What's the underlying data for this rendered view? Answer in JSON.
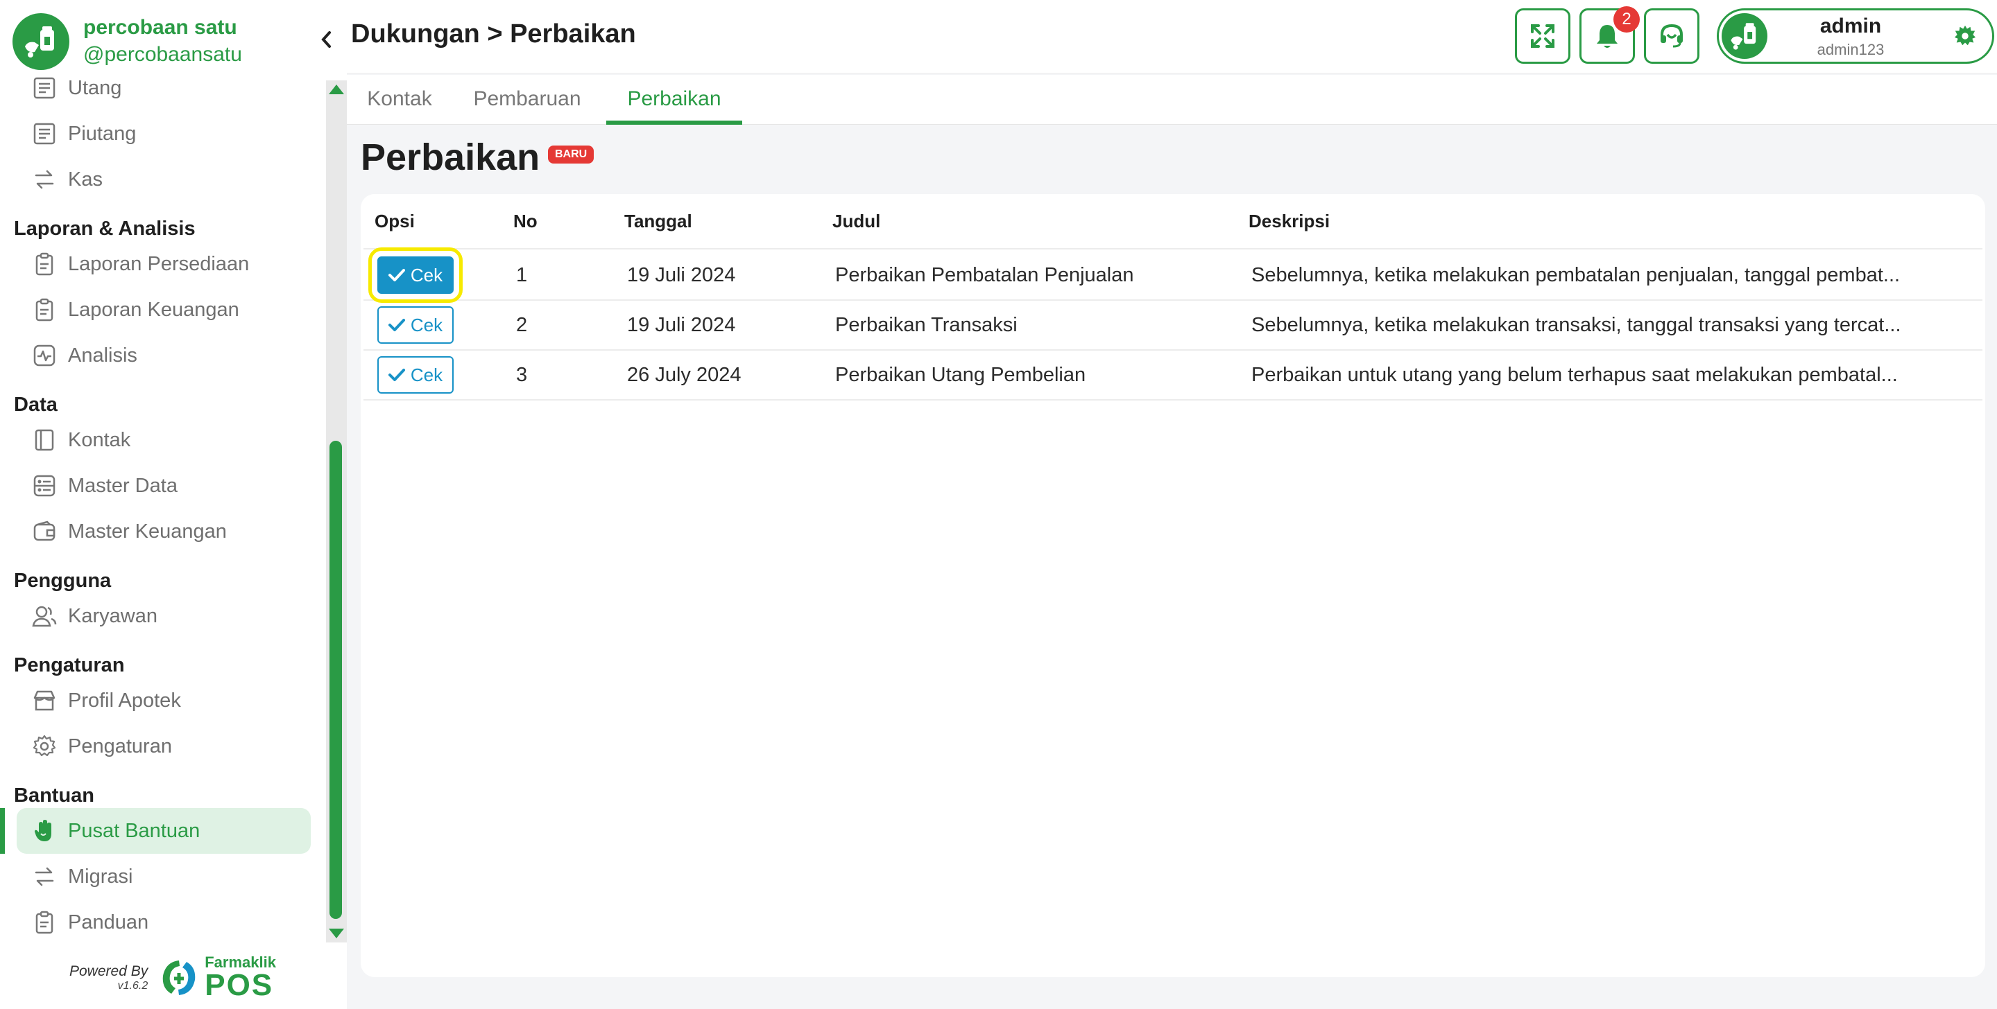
{
  "brand": {
    "name": "percobaan satu",
    "handle": "@percobaansatu"
  },
  "sidebar": {
    "items_top": [
      {
        "label": "Utang",
        "icon": "ledger-icon"
      },
      {
        "label": "Piutang",
        "icon": "ledger-icon"
      },
      {
        "label": "Kas",
        "icon": "transfer-icon"
      }
    ],
    "sections": [
      {
        "title": "Laporan & Analisis",
        "items": [
          {
            "label": "Laporan Persediaan",
            "icon": "clipboard-icon"
          },
          {
            "label": "Laporan Keuangan",
            "icon": "clipboard-icon"
          },
          {
            "label": "Analisis",
            "icon": "pulse-icon"
          }
        ]
      },
      {
        "title": "Data",
        "items": [
          {
            "label": "Kontak",
            "icon": "book-icon"
          },
          {
            "label": "Master Data",
            "icon": "database-icon"
          },
          {
            "label": "Master Keuangan",
            "icon": "wallet-icon"
          }
        ]
      },
      {
        "title": "Pengguna",
        "items": [
          {
            "label": "Karyawan",
            "icon": "users-icon"
          }
        ]
      },
      {
        "title": "Pengaturan",
        "items": [
          {
            "label": "Profil Apotek",
            "icon": "store-icon"
          },
          {
            "label": "Pengaturan",
            "icon": "gear-icon"
          }
        ]
      },
      {
        "title": "Bantuan",
        "items": [
          {
            "label": "Pusat Bantuan",
            "icon": "hand-icon",
            "active": true
          },
          {
            "label": "Migrasi",
            "icon": "transfer-icon"
          },
          {
            "label": "Panduan",
            "icon": "clipboard-icon"
          }
        ]
      }
    ]
  },
  "footer": {
    "powered_by": "Powered By",
    "version": "v1.6.2",
    "logo_name": "Farmaklik",
    "logo_pos": "POS"
  },
  "header": {
    "breadcrumb": "Dukungan > Perbaikan",
    "notification_count": "2",
    "user": {
      "name": "admin",
      "username": "admin123"
    }
  },
  "tabs": [
    {
      "label": "Kontak",
      "active": false
    },
    {
      "label": "Pembaruan",
      "active": false
    },
    {
      "label": "Perbaikan",
      "active": true
    }
  ],
  "page": {
    "title": "Perbaikan",
    "badge": "BARU"
  },
  "table": {
    "columns": [
      "Opsi",
      "No",
      "Tanggal",
      "Judul",
      "Deskripsi"
    ],
    "button_label": "Cek",
    "rows": [
      {
        "no": "1",
        "tanggal": "19 Juli 2024",
        "judul": "Perbaikan Pembatalan Penjualan",
        "deskripsi": "Sebelumnya, ketika melakukan pembatalan penjualan, tanggal pembat..."
      },
      {
        "no": "2",
        "tanggal": "19 Juli 2024",
        "judul": "Perbaikan Transaksi",
        "deskripsi": "Sebelumnya, ketika melakukan transaksi, tanggal transaksi yang tercat..."
      },
      {
        "no": "3",
        "tanggal": "26 July 2024",
        "judul": "Perbaikan Utang Pembelian",
        "deskripsi": "Perbaikan untuk utang yang belum terhapus saat melakukan pembatal..."
      }
    ]
  },
  "colors": {
    "primary": "#2a9b45",
    "accent_blue": "#1792c7",
    "badge_red": "#e53935",
    "focus_yellow": "#f7ea00"
  }
}
